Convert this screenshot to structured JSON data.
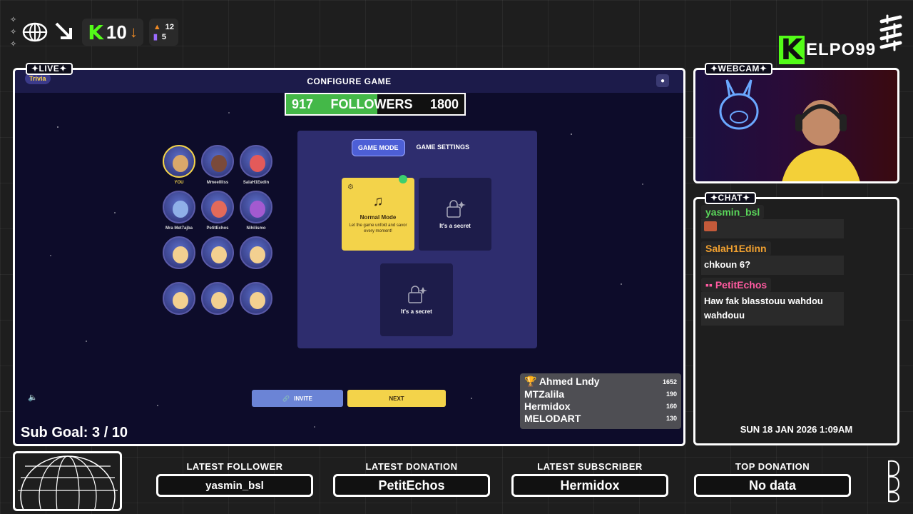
{
  "topStats": {
    "platform_letter": "K",
    "viewers": "10",
    "stat1": "12",
    "stat2": "5"
  },
  "brand": {
    "letter": "K",
    "name": "ELPO99"
  },
  "tags": {
    "live": "✦LIVE✦",
    "webcam": "✦WEBCAM✦",
    "chat": "✦CHAT✦"
  },
  "game": {
    "title": "CONFIGURE GAME",
    "logo": "Trivia",
    "followers": {
      "current": "917",
      "label": "FOLLOWERS",
      "goal": "1800",
      "progress_fraction": 0.51
    },
    "avatars": [
      {
        "name": "YOU",
        "color": "#d9a86a"
      },
      {
        "name": "Mmeellliss",
        "color": "#7a4a3a"
      },
      {
        "name": "SalaH1Eedin",
        "color": "#e35a5a"
      },
      {
        "name": "Mra Met7ajba",
        "color": "#8fb0e8"
      },
      {
        "name": "PetitEchos",
        "color": "#e36a5a"
      },
      {
        "name": "Nihilismo",
        "color": "#a35ad0"
      },
      {
        "name": "",
        "color": "#f3d090"
      },
      {
        "name": "",
        "color": "#f3d090"
      },
      {
        "name": "",
        "color": "#f3d090"
      },
      {
        "name": "",
        "color": "#f3d090"
      },
      {
        "name": "",
        "color": "#f3d090"
      },
      {
        "name": "",
        "color": "#f3d090"
      }
    ],
    "tabs": {
      "mode": "GAME MODE",
      "settings": "GAME SETTINGS"
    },
    "cards": {
      "normal_title": "Normal Mode",
      "normal_desc": "Let the game unfold and savor every moment!",
      "secret1": "It's a secret",
      "secret2": "It's a secret"
    },
    "buttons": {
      "invite": "INVITE",
      "next": "NEXT"
    }
  },
  "leaderboard": [
    {
      "name": "Ahmed Lndy",
      "score": "1652"
    },
    {
      "name": "MTZalila",
      "score": "190"
    },
    {
      "name": "Hermidox",
      "score": "160"
    },
    {
      "name": "MELODART",
      "score": "130"
    }
  ],
  "subGoal": {
    "label": "Sub Goal:",
    "value": "3 / 10"
  },
  "chat": {
    "messages": [
      {
        "user": "yasmin_bsl",
        "body": ""
      },
      {
        "user": "SalaH1Edinn",
        "body": "chkoun 6?"
      },
      {
        "user": "PetitEchos",
        "body": "Haw fak blasstouu wahdou wahdouu"
      }
    ],
    "date": "SUN 18 JAN 2026 1:09AM"
  },
  "bottomStats": {
    "latest_follower_label": "LATEST FOLLOWER",
    "latest_follower": "yasmin_bsl",
    "latest_donation_label": "LATEST DONATION",
    "latest_donation": "PetitEchos",
    "latest_subscriber_label": "LATEST SUBSCRIBER",
    "latest_subscriber": "Hermidox",
    "top_donation_label": "TOP DONATION",
    "top_donation": "No data"
  },
  "colors": {
    "kick_green": "#53fc18",
    "frame_bg": "#0d0c2a",
    "panel": "#2e2d6e",
    "accent_yellow": "#f3d34a",
    "accent_blue": "#4d5fd6"
  },
  "icons": {
    "globe": "globe-icon",
    "arrow": "arrow-down-right-icon",
    "close": "close-icon",
    "speaker": "speaker-icon",
    "trophy": "trophy-icon",
    "link": "link-icon",
    "gear": "gear-icon",
    "lock": "lock-icon"
  }
}
